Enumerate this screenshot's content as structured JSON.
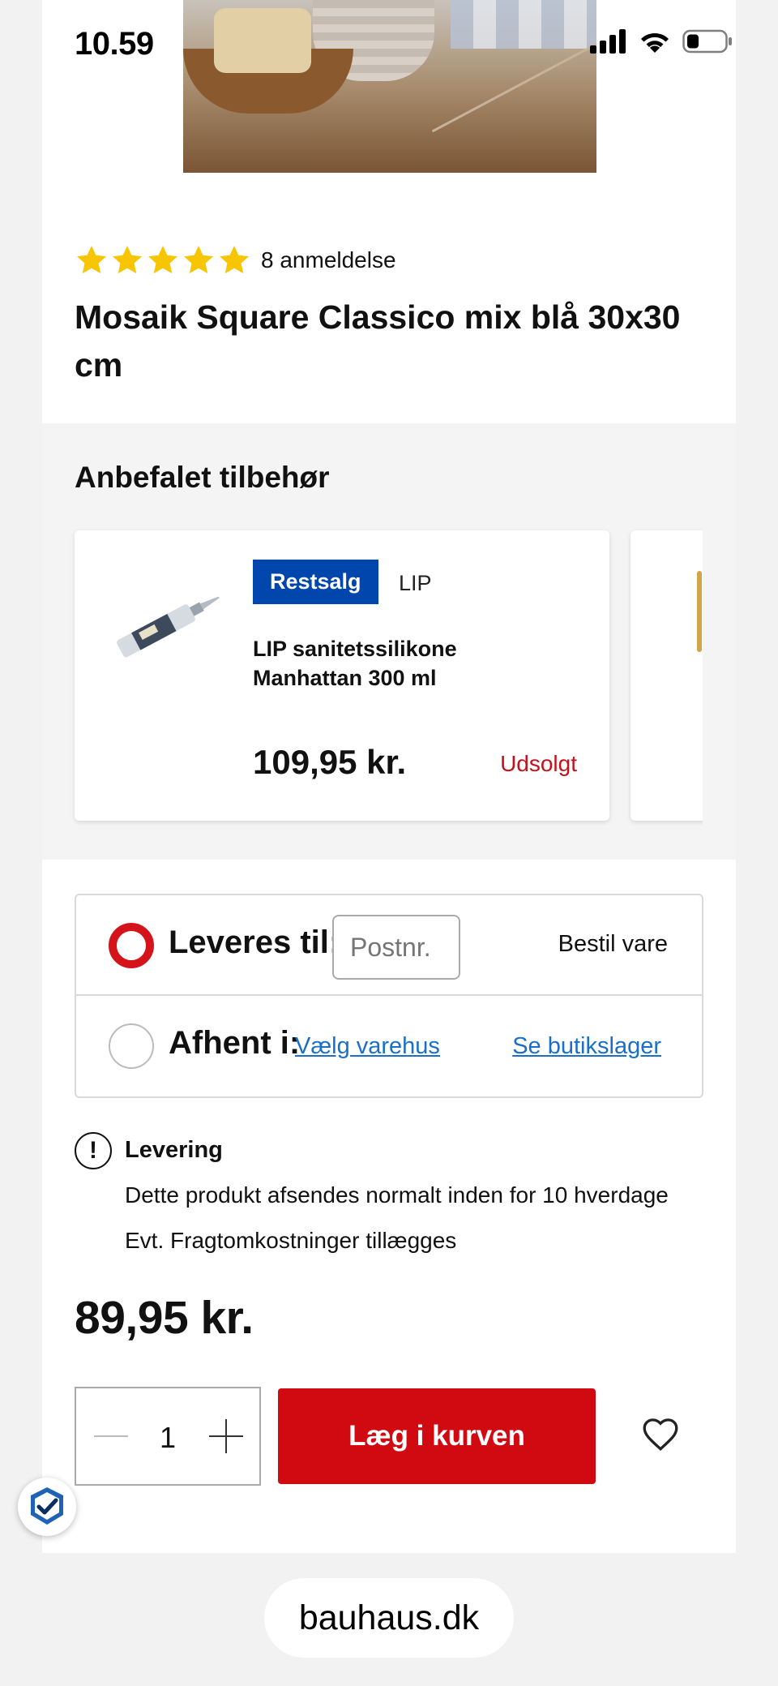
{
  "status_bar": {
    "time": "10.59"
  },
  "product": {
    "rating": {
      "stars": 5,
      "review_count_text": "8 anmeldelse"
    },
    "title": "Mosaik Square Classico mix blå 30x30 cm"
  },
  "accessories": {
    "heading": "Anbefalet tilbehør",
    "items": [
      {
        "badge": "Restsalg",
        "brand": "LIP",
        "name": "LIP sanitetssilikone Manhattan 300 ml",
        "price": "109,95 kr.",
        "stock_status": "Udsolgt"
      }
    ]
  },
  "delivery": {
    "deliver_label": "Leveres til:",
    "postal_placeholder": "Postnr.",
    "order_item": "Bestil vare",
    "pickup_label": "Afhent i:",
    "choose_store_link": "Vælg varehus",
    "store_stock_link": "Se butikslager"
  },
  "shipping_info": {
    "title": "Levering",
    "line1": "Dette produkt afsendes normalt inden for 10 hverdage",
    "line2": "Evt. Fragtomkostninger tillægges"
  },
  "price": "89,95 kr.",
  "purchase": {
    "quantity": "1",
    "add_to_cart": "Læg i kurven"
  },
  "browser": {
    "url": "bauhaus.dk"
  },
  "colors": {
    "accent_red": "#d10a11",
    "badge_blue": "#0046ad",
    "link_blue": "#1a6fc9",
    "star_yellow": "#f7c600"
  }
}
